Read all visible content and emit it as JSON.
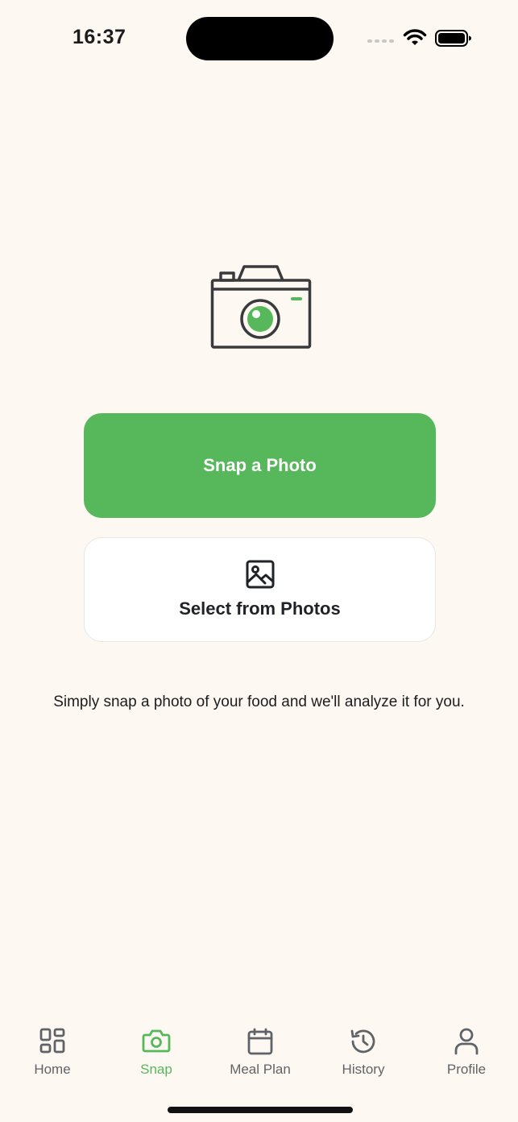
{
  "status_bar": {
    "time": "16:37"
  },
  "hero": {
    "icon": "camera-icon"
  },
  "actions": {
    "snap_label": "Snap a Photo",
    "select_label": "Select from Photos"
  },
  "helper_text": "Simply snap a photo of your food and we'll analyze it for you.",
  "tabs": [
    {
      "label": "Home",
      "icon": "grid-icon",
      "active": false
    },
    {
      "label": "Snap",
      "icon": "camera-icon",
      "active": true
    },
    {
      "label": "Meal Plan",
      "icon": "calendar-icon",
      "active": false
    },
    {
      "label": "History",
      "icon": "history-icon",
      "active": false
    },
    {
      "label": "Profile",
      "icon": "user-icon",
      "active": false
    }
  ],
  "colors": {
    "accent": "#56b85b",
    "background": "#fdf9f2",
    "icon_gray": "#5f6368"
  }
}
